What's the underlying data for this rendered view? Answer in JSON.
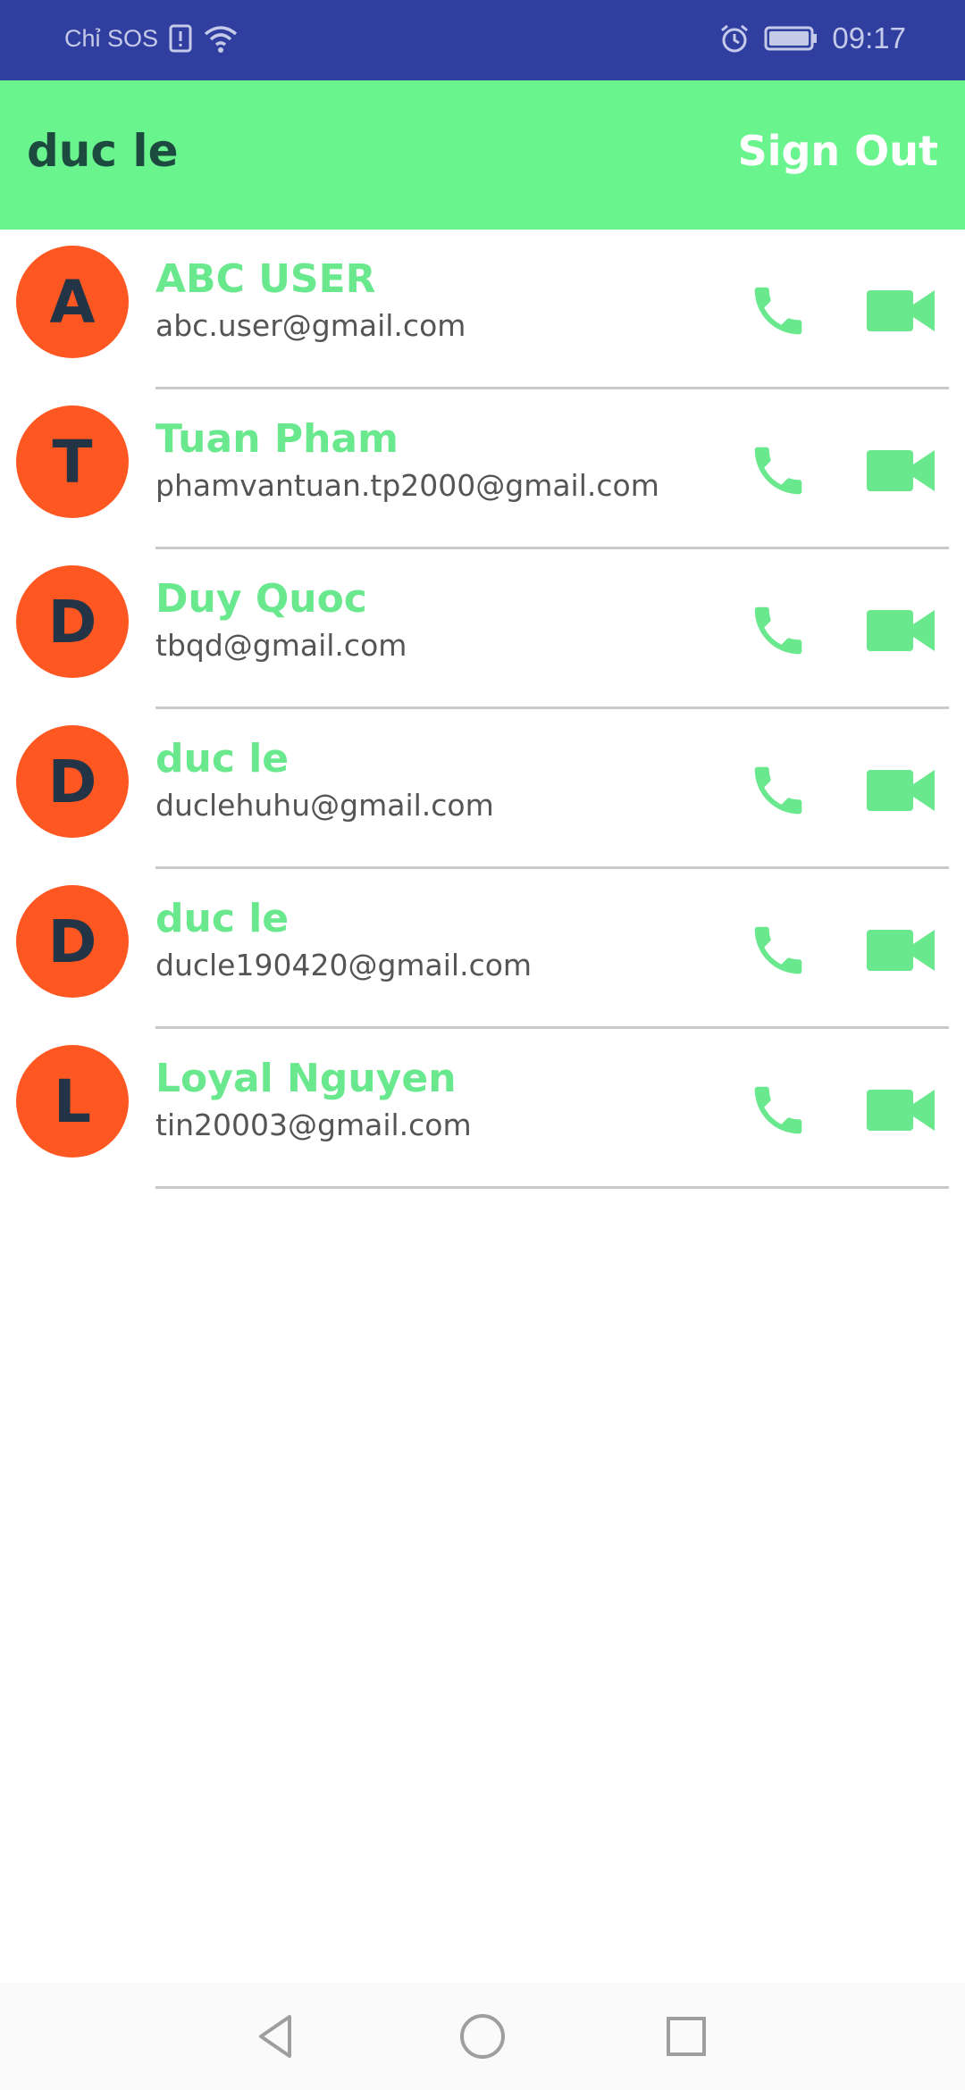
{
  "status_bar": {
    "carrier": "Chỉ SOS",
    "time": "09:17",
    "icons": [
      "sim-alert-icon",
      "wifi-icon",
      "alarm-icon",
      "battery-icon"
    ]
  },
  "header": {
    "title": "duc le",
    "sign_out_label": "Sign Out"
  },
  "contacts": [
    {
      "initial": "A",
      "name": "ABC USER",
      "email": "abc.user@gmail.com"
    },
    {
      "initial": "T",
      "name": "Tuan Pham",
      "email": "phamvantuan.tp2000@gmail.com"
    },
    {
      "initial": "D",
      "name": "Duy Quoc",
      "email": "tbqd@gmail.com"
    },
    {
      "initial": "D",
      "name": "duc le",
      "email": "duclehuhu@gmail.com"
    },
    {
      "initial": "D",
      "name": "duc le",
      "email": "ducle190420@gmail.com"
    },
    {
      "initial": "L",
      "name": "Loyal Nguyen",
      "email": "tin20003@gmail.com"
    }
  ],
  "row_icons": [
    "phone-icon",
    "video-camera-icon"
  ],
  "nav_bar": [
    "back-icon",
    "home-icon",
    "recents-icon"
  ],
  "colors": {
    "status_bar": "#303f9f",
    "app_bar": "#69f48e",
    "accent_green": "#69e88e",
    "avatar": "#ff5722",
    "avatar_text": "#243447"
  }
}
